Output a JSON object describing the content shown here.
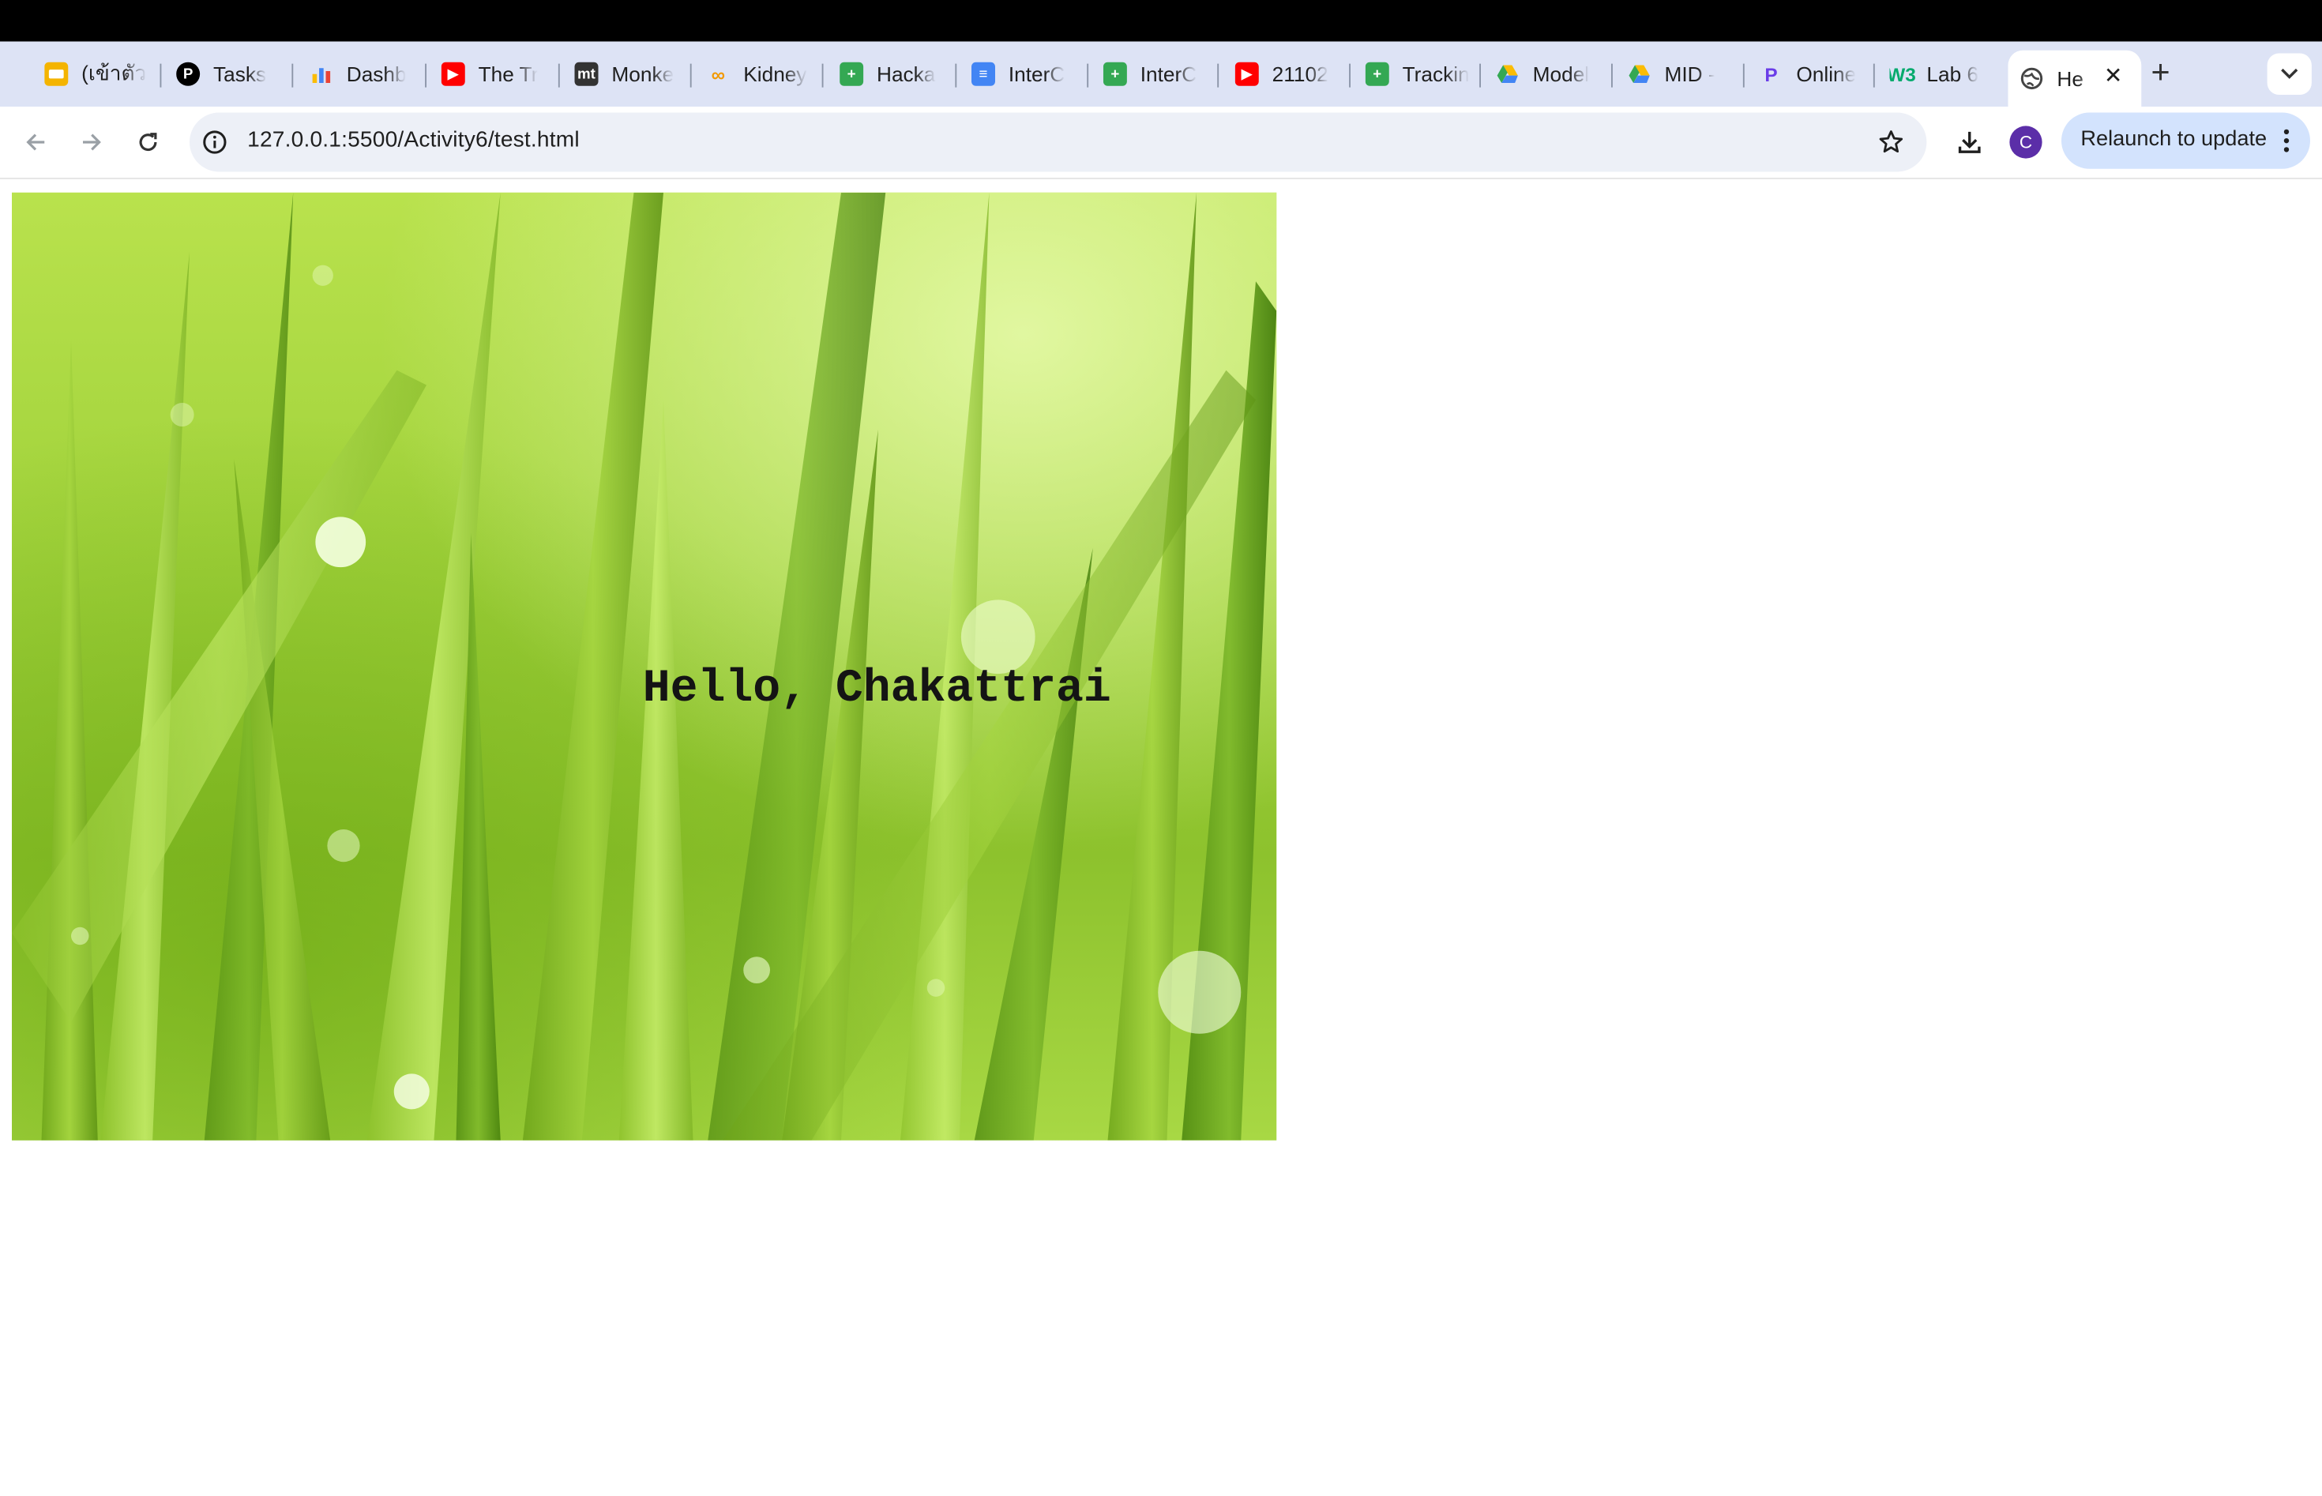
{
  "tabs": [
    {
      "title": "(เข้าตัว",
      "icon": "slides-icon",
      "color": "#f4b400"
    },
    {
      "title": "Tasks",
      "icon": "p-logo-icon",
      "color": "#000000"
    },
    {
      "title": "Dashb",
      "icon": "bar-chart-icon",
      "color": "#4285f4"
    },
    {
      "title": "The Tr",
      "icon": "youtube-icon",
      "color": "#ff0000"
    },
    {
      "title": "Monke",
      "icon": "mt-logo-icon",
      "color": "#333333"
    },
    {
      "title": "Kidney",
      "icon": "infinity-icon",
      "color": "#f29900"
    },
    {
      "title": "Hacka",
      "icon": "sheets-icon",
      "color": "#34a853"
    },
    {
      "title": "InterC",
      "icon": "docs-icon",
      "color": "#4285f4"
    },
    {
      "title": "InterC",
      "icon": "sheets-icon",
      "color": "#34a853"
    },
    {
      "title": "21102",
      "icon": "youtube-icon",
      "color": "#ff0000"
    },
    {
      "title": "Trackin",
      "icon": "sheets-icon",
      "color": "#34a853"
    },
    {
      "title": "Model",
      "icon": "drive-icon",
      "color": "#fbbc04"
    },
    {
      "title": "MID -",
      "icon": "drive-icon",
      "color": "#fbbc04"
    },
    {
      "title": "Online",
      "icon": "p-purple-icon",
      "color": "#6a3de8"
    },
    {
      "title": "Lab 6",
      "icon": "w3-logo-icon",
      "color": "#04aa6d"
    }
  ],
  "active_tab": {
    "title": "He",
    "icon": "globe-icon"
  },
  "toolbar": {
    "url": "127.0.0.1:5500/Activity6/test.html",
    "relaunch_label": "Relaunch to update",
    "avatar_letter": "C"
  },
  "page": {
    "greeting": "Hello, Chakattrai"
  }
}
